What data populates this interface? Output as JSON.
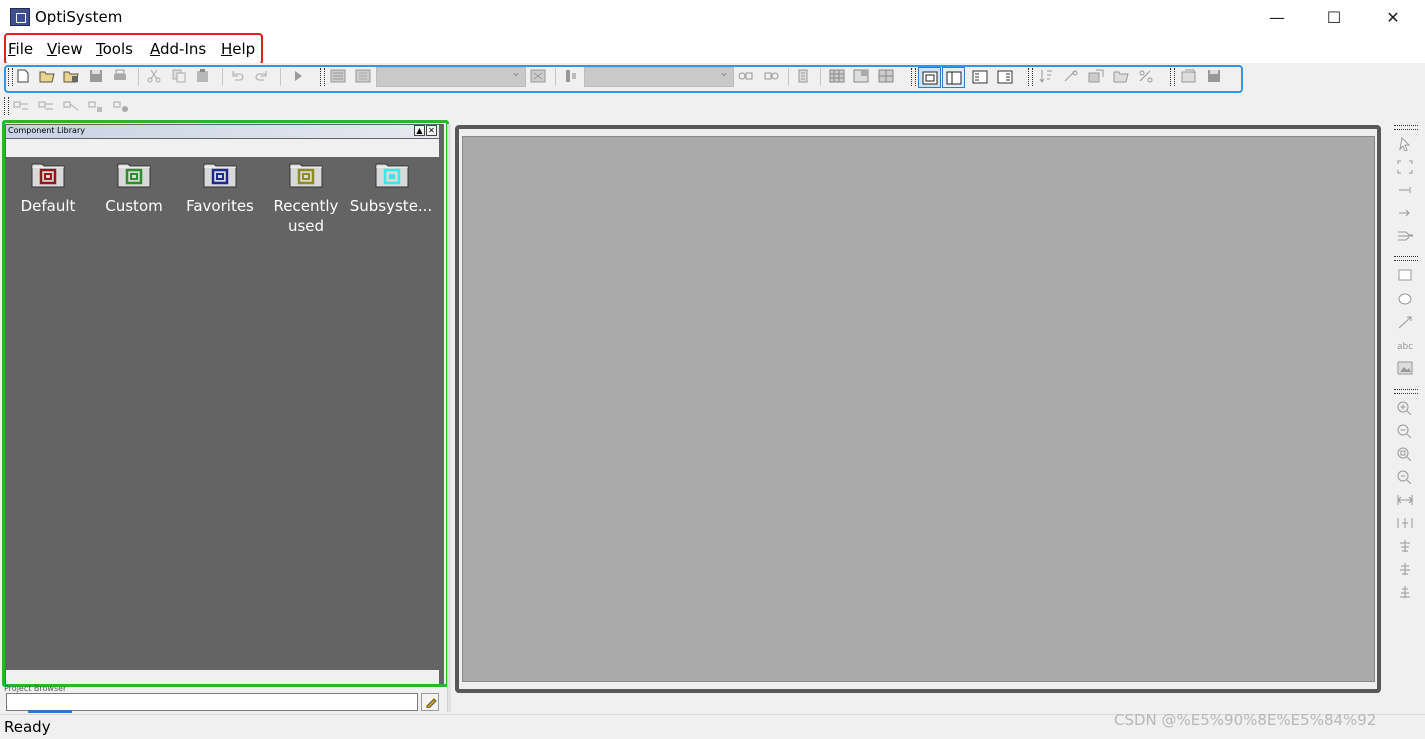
{
  "window": {
    "title": "OptiSystem",
    "minimize_glyph": "—",
    "maximize_glyph": "☐",
    "close_glyph": "✕"
  },
  "menu": {
    "items": [
      "File",
      "View",
      "Tools",
      "Add-Ins",
      "Help"
    ]
  },
  "component_library": {
    "title": "Component Library",
    "folders": [
      {
        "label": "Default",
        "color": "#8b1a1a"
      },
      {
        "label": "Custom",
        "color": "#2e8b2e"
      },
      {
        "label": "Favorites",
        "color": "#1c2a8c"
      },
      {
        "label": "Recently used",
        "color": "#8e8a2a"
      },
      {
        "label": "Subsyste...",
        "color": "#39e7e7"
      }
    ]
  },
  "project_browser": {
    "title": "Project Browser"
  },
  "status": {
    "text": "Ready"
  },
  "watermark": "CSDN @%E5%90%8E%E5%84%92",
  "colors": {
    "menu_highlight": "#e0201c",
    "toolbar_highlight": "#2e97ea",
    "library_highlight": "#28b728",
    "library_background": "#646464",
    "canvas_background": "#aaaaaa"
  }
}
